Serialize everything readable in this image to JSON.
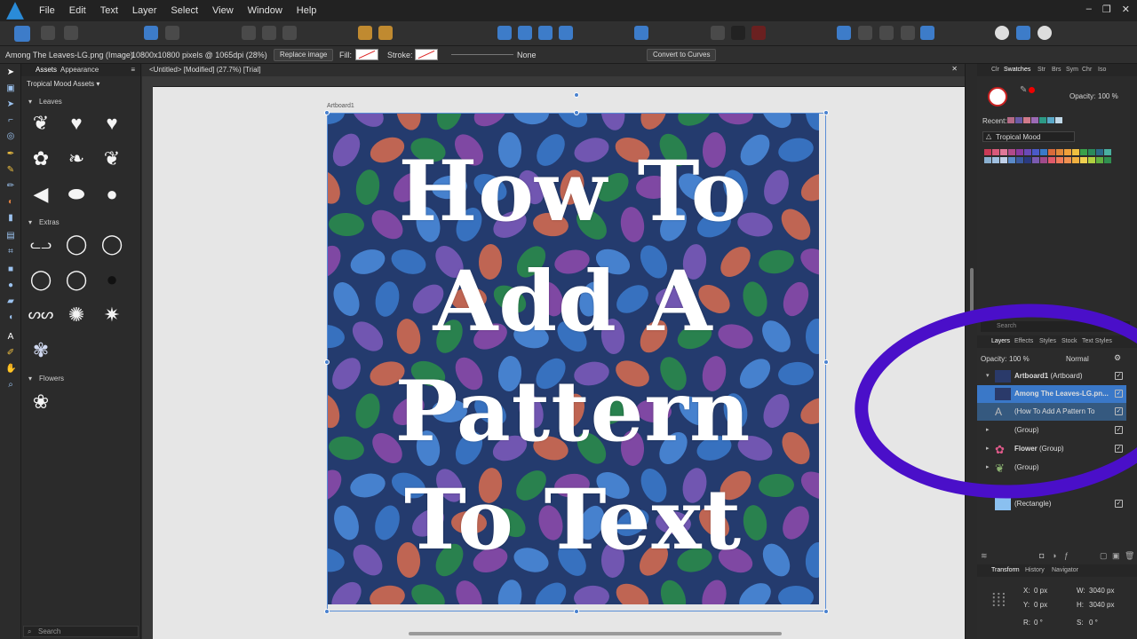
{
  "menubar": {
    "items": [
      "File",
      "Edit",
      "Text",
      "Layer",
      "Select",
      "View",
      "Window",
      "Help"
    ]
  },
  "context": {
    "object_name": "Among The Leaves-LG.png (Image)",
    "pixels_info": "10800x10800 pixels @ 1065dpi (28%)",
    "replace_image": "Replace image",
    "fill_label": "Fill:",
    "stroke_label": "Stroke:",
    "stroke_value": "None",
    "convert_label": "Convert to Curves"
  },
  "assets_panel": {
    "tabs": [
      "Assets",
      "Appearance"
    ],
    "category": "Tropical Mood Assets",
    "sections": [
      "Leaves",
      "Extras",
      "Flowers"
    ],
    "search_placeholder": "Search"
  },
  "document": {
    "tab_title": "<Untitled> [Modified] (27.7%) [Trial]",
    "artboard_label": "Artboard1",
    "lines": [
      "How To",
      "Add A",
      "Pattern",
      "To Text"
    ],
    "pattern_bg": "#243b6e"
  },
  "swatches": {
    "tabs": [
      "Clr",
      "Swatches",
      "Str",
      "Brs",
      "Sym",
      "Chr",
      "Iso"
    ],
    "opacity_label": "Opacity:",
    "opacity_value": "100 %",
    "recent_label": "Recent:",
    "palette_name": "Tropical Mood",
    "recent_colors": [
      "#b56a86",
      "#6a5aa5",
      "#d07a8a",
      "#9c6ab4",
      "#2c9a86",
      "#5aa8c8",
      "#c0d8e8"
    ],
    "palette_colors": [
      "#c83a56",
      "#d85a7a",
      "#e07898",
      "#b04a8a",
      "#8a3aa0",
      "#6a4ab8",
      "#4a5ac8",
      "#3a7ac8",
      "#d86a3a",
      "#e0883a",
      "#f0a03a",
      "#f0c040",
      "#3aa04a",
      "#2a8a5a",
      "#2a6a8a",
      "#4ab0a0",
      "#8ab0d0",
      "#a0c0e0",
      "#c0d0e8",
      "#5a8ac8",
      "#3a5aa0",
      "#2a3a80",
      "#7a5ab0",
      "#a04a8a",
      "#e05a6a",
      "#f07a5a",
      "#f09050",
      "#f0b040",
      "#f0d050",
      "#b0d040",
      "#60b040",
      "#309050"
    ]
  },
  "layers": {
    "search_placeholder": "Search",
    "tabs": [
      "Layers",
      "Effects",
      "Styles",
      "Stock",
      "Text Styles"
    ],
    "opacity_label": "Opacity:",
    "opacity_value": "100 %",
    "blend_mode": "Normal",
    "rows": [
      {
        "name": "Artboard1",
        "type": "(Artboard)"
      },
      {
        "name": "Among The Leaves-LG.pn...",
        "type": ""
      },
      {
        "name": "(How To Add A Pattern To",
        "type": ""
      },
      {
        "name": "",
        "type": "(Group)"
      },
      {
        "name": "Flower",
        "type": "(Group)"
      },
      {
        "name": "",
        "type": "(Group)"
      },
      {
        "name": "",
        "type": "(Rectangle)"
      }
    ]
  },
  "transform": {
    "tabs": [
      "Transform",
      "History",
      "Navigator"
    ],
    "x_label": "X:",
    "x_value": "0 px",
    "y_label": "Y:",
    "y_value": "0 px",
    "w_label": "W:",
    "w_value": "3040 px",
    "h_label": "H:",
    "h_value": "3040 px",
    "r_label": "R:",
    "r_value": "0 °",
    "s_label": "S:",
    "s_value": "0 °"
  }
}
